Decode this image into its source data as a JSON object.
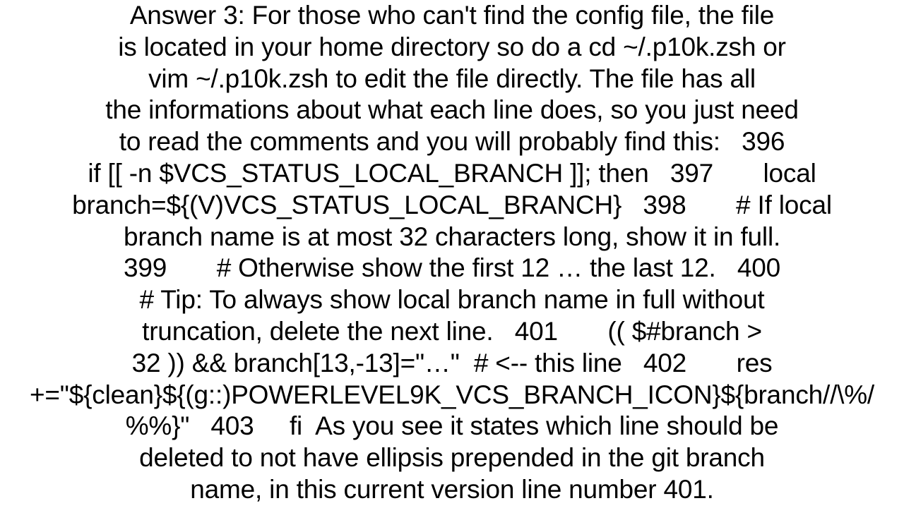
{
  "document": {
    "lines": [
      "Answer 3: For those who can't find the config file, the file",
      "is located in your home directory so do a cd ~/.p10k.zsh or",
      "vim ~/.p10k.zsh to edit the file directly. The file has all",
      "the informations about what each line does, so you just need",
      "to read the comments and you will probably find this:   396",
      "if [[ -n $VCS_STATUS_LOCAL_BRANCH ]]; then   397       local",
      "branch=${(V)VCS_STATUS_LOCAL_BRANCH}   398       # If local",
      "branch name is at most 32 characters long, show it in full.",
      "399       # Otherwise show the first 12 … the last 12.   400",
      "# Tip: To always show local branch name in full without",
      "truncation, delete the next line.   401       (( $#branch >",
      "32 )) && branch[13,-13]=\"…\"  # <-- this line   402       res",
      "+=\"${clean}${(g::)POWERLEVEL9K_VCS_BRANCH_ICON}${branch//\\%/",
      "%%}\"   403     fi  As you see it states which line should be",
      "deleted to not have ellipsis prepended in the git branch",
      "name, in this current version line number 401."
    ]
  }
}
